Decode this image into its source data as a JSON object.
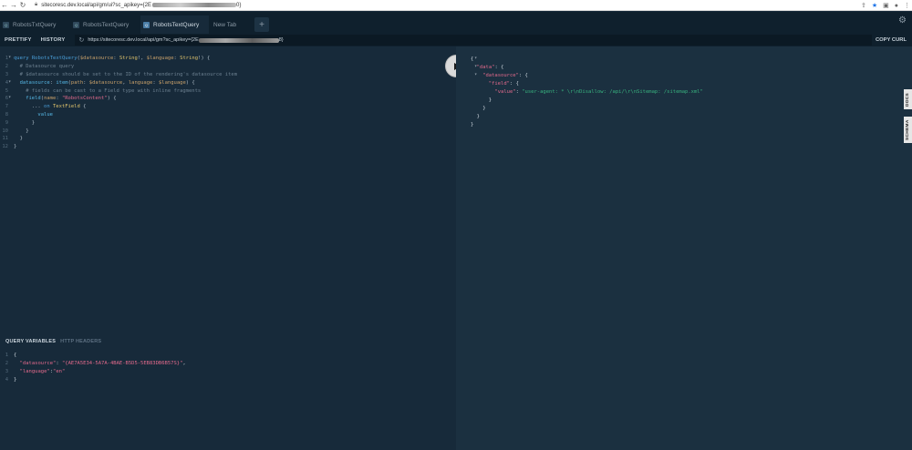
{
  "browser": {
    "url_prefix": "sitecoresc.dev.local/api/gm/ui?sc_apikey={2E",
    "url_suffix": "0}"
  },
  "tabs": [
    {
      "label": "RobotsTxtQuery",
      "active": false
    },
    {
      "label": "RobotsTextQuery",
      "active": false
    },
    {
      "label": "RobotsTextQuery",
      "active": true
    },
    {
      "label": "New Tab",
      "active": false
    }
  ],
  "toolbar": {
    "prettify": "PRETTIFY",
    "history": "HISTORY",
    "endpoint_prefix": "https://sitecoresc.dev.local/api/gm?sc_apikey={2E",
    "endpoint_suffix": "8}",
    "copy_curl": "COPY CURL"
  },
  "editor": {
    "lines": [
      {
        "n": "1",
        "fold": "▾",
        "indent": 0,
        "parts": [
          [
            "kw",
            "query "
          ],
          [
            "name",
            "RobotsTextQuery"
          ],
          [
            "punct",
            "("
          ],
          [
            "var",
            "$datasource"
          ],
          [
            "punct",
            ": "
          ],
          [
            "type",
            "String"
          ],
          [
            "punct",
            "!, "
          ],
          [
            "var",
            "$language"
          ],
          [
            "punct",
            ": "
          ],
          [
            "type",
            "String"
          ],
          [
            "punct",
            "!) {"
          ]
        ]
      },
      {
        "n": "2",
        "fold": "",
        "indent": 2,
        "parts": [
          [
            "comment",
            "# Datasource query"
          ]
        ]
      },
      {
        "n": "3",
        "fold": "",
        "indent": 2,
        "parts": [
          [
            "comment",
            "# $datasource should be set to the ID of the rendering's datasource item"
          ]
        ]
      },
      {
        "n": "4",
        "fold": "▾",
        "indent": 2,
        "parts": [
          [
            "fieldc",
            "datasource"
          ],
          [
            "punct",
            ": "
          ],
          [
            "fieldc",
            "item"
          ],
          [
            "punct",
            "("
          ],
          [
            "argc",
            "path"
          ],
          [
            "punct",
            ": "
          ],
          [
            "var",
            "$datasource"
          ],
          [
            "punct",
            ", "
          ],
          [
            "argc",
            "language"
          ],
          [
            "punct",
            ": "
          ],
          [
            "var",
            "$language"
          ],
          [
            "punct",
            ") {"
          ]
        ]
      },
      {
        "n": "5",
        "fold": "",
        "indent": 4,
        "parts": [
          [
            "comment",
            "# fields can be cast to a Field type with inline fragments"
          ]
        ]
      },
      {
        "n": "6",
        "fold": "▾",
        "indent": 4,
        "parts": [
          [
            "fieldc",
            "field"
          ],
          [
            "punct",
            "("
          ],
          [
            "argc",
            "name"
          ],
          [
            "punct",
            ": "
          ],
          [
            "str",
            "\"RobotsContent\""
          ],
          [
            "punct",
            ") {"
          ]
        ]
      },
      {
        "n": "7",
        "fold": "",
        "indent": 6,
        "parts": [
          [
            "punct",
            "... "
          ],
          [
            "kw",
            "on "
          ],
          [
            "type",
            "TextField"
          ],
          [
            "punct",
            " {"
          ]
        ]
      },
      {
        "n": "8",
        "fold": "",
        "indent": 8,
        "parts": [
          [
            "fieldc",
            "value"
          ]
        ]
      },
      {
        "n": "9",
        "fold": "",
        "indent": 6,
        "parts": [
          [
            "punct",
            "}"
          ]
        ]
      },
      {
        "n": "10",
        "fold": "",
        "indent": 4,
        "parts": [
          [
            "punct",
            "}"
          ]
        ]
      },
      {
        "n": "11",
        "fold": "",
        "indent": 2,
        "parts": [
          [
            "punct",
            "}"
          ]
        ]
      },
      {
        "n": "12",
        "fold": "",
        "indent": 0,
        "parts": [
          [
            "punct",
            "}"
          ]
        ]
      }
    ]
  },
  "result": {
    "lines": [
      {
        "fold": "▾",
        "indent": 0,
        "parts": [
          [
            "white",
            "{"
          ]
        ]
      },
      {
        "fold": "▾",
        "indent": 2,
        "parts": [
          [
            "rkey",
            "\"data\""
          ],
          [
            "white",
            ": {"
          ]
        ]
      },
      {
        "fold": "▾",
        "indent": 4,
        "parts": [
          [
            "rkey",
            "\"datasource\""
          ],
          [
            "white",
            ": {"
          ]
        ]
      },
      {
        "fold": "",
        "indent": 6,
        "parts": [
          [
            "rkey",
            "\"field\""
          ],
          [
            "white",
            ": {"
          ]
        ]
      },
      {
        "fold": "",
        "indent": 8,
        "parts": [
          [
            "rkey",
            "\"value\""
          ],
          [
            "white",
            ": "
          ],
          [
            "rstr",
            "\"user-agent: * \\r\\nDisallow: /api/\\r\\nSitemap: /sitemap.xml\""
          ]
        ]
      },
      {
        "fold": "",
        "indent": 6,
        "parts": [
          [
            "white",
            "}"
          ]
        ]
      },
      {
        "fold": "",
        "indent": 4,
        "parts": [
          [
            "white",
            "}"
          ]
        ]
      },
      {
        "fold": "",
        "indent": 2,
        "parts": [
          [
            "white",
            "}"
          ]
        ]
      },
      {
        "fold": "",
        "indent": 0,
        "parts": [
          [
            "white",
            "}"
          ]
        ]
      }
    ]
  },
  "side_tabs": {
    "docs": "DOCS",
    "schema": "SCHEMA"
  },
  "variables": {
    "tab_query_variables": "QUERY VARIABLES",
    "tab_http_headers": "HTTP HEADERS",
    "lines": [
      {
        "n": "1",
        "indent": 0,
        "parts": [
          [
            "white",
            "{"
          ]
        ]
      },
      {
        "n": "2",
        "indent": 2,
        "parts": [
          [
            "str",
            "\"datasource\""
          ],
          [
            "white",
            ": "
          ],
          [
            "str",
            "\"{AE7A5E34-5A7A-4BAE-B5D5-5EB83DB6B57S}\""
          ],
          [
            "white",
            ","
          ]
        ]
      },
      {
        "n": "3",
        "indent": 2,
        "parts": [
          [
            "str",
            "\"language\""
          ],
          [
            "white",
            ":"
          ],
          [
            "str",
            "\"en\""
          ]
        ]
      },
      {
        "n": "4",
        "indent": 0,
        "parts": [
          [
            "white",
            "}"
          ]
        ]
      }
    ]
  }
}
